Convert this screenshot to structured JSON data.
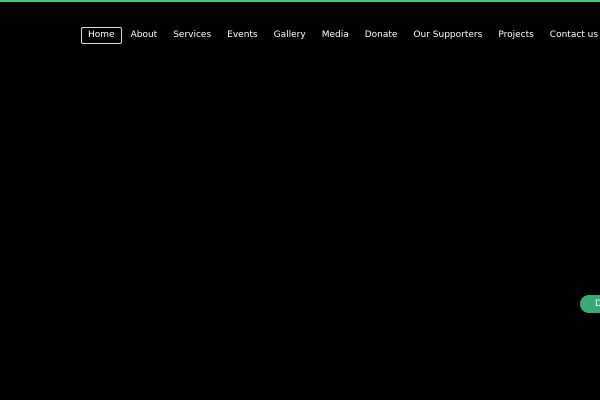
{
  "theme": {
    "background": "#000000",
    "accent": "#3ec882",
    "side_tab_color": "#3aa877",
    "nav_text": "#ffffff",
    "active_border": "#d8d8d8"
  },
  "nav": {
    "items": [
      {
        "label": "Home",
        "active": true
      },
      {
        "label": "About",
        "active": false
      },
      {
        "label": "Services",
        "active": false
      },
      {
        "label": "Events",
        "active": false
      },
      {
        "label": "Gallery",
        "active": false
      },
      {
        "label": "Media",
        "active": false
      },
      {
        "label": "Donate",
        "active": false
      },
      {
        "label": "Our Supporters",
        "active": false
      },
      {
        "label": "Projects",
        "active": false
      },
      {
        "label": "Contact us",
        "active": false
      }
    ]
  },
  "side_tab": {
    "label": "D"
  }
}
